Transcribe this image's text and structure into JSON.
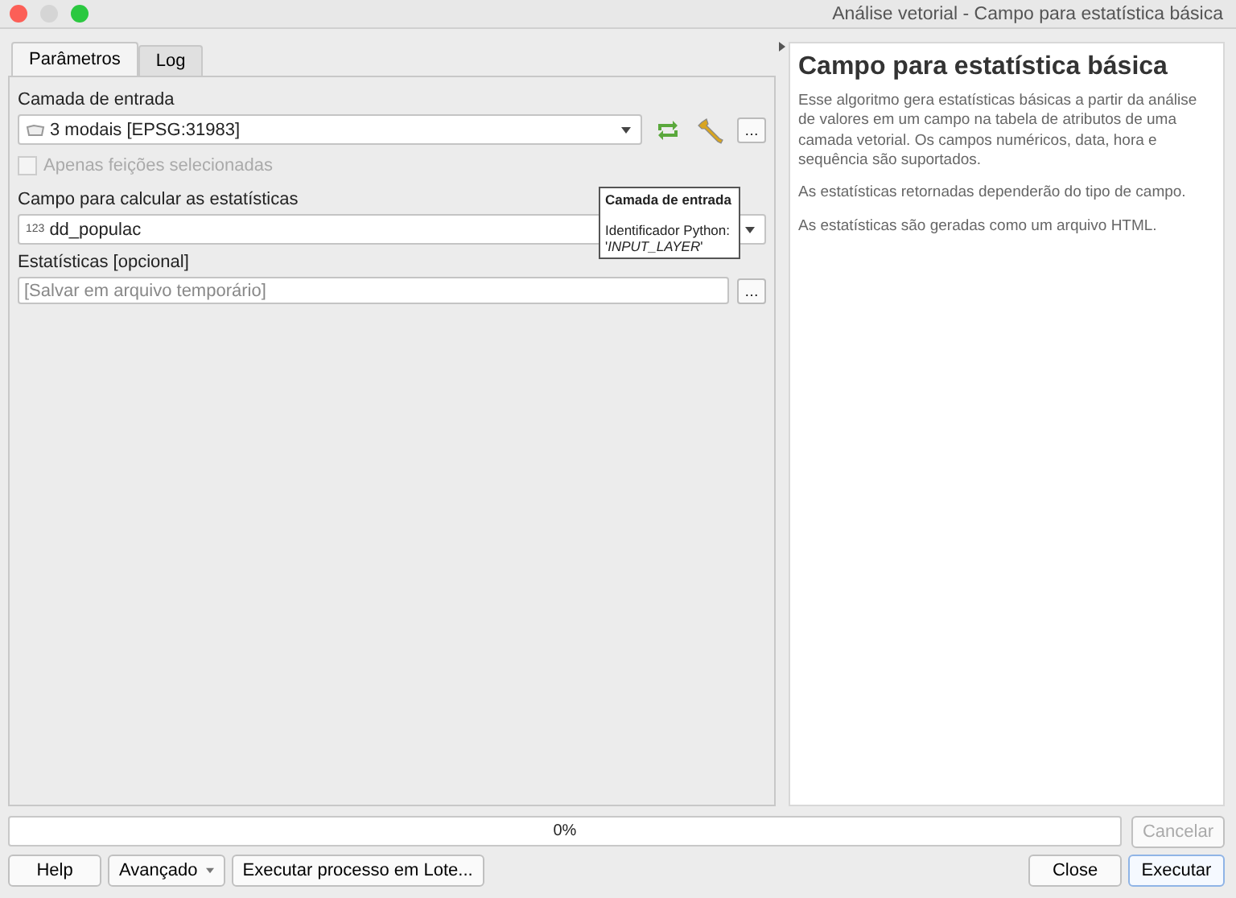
{
  "window": {
    "title": "Análise vetorial - Campo para estatística básica"
  },
  "tabs": [
    {
      "label": "Parâmetros",
      "selected": true
    },
    {
      "label": "Log",
      "selected": false
    }
  ],
  "params": {
    "input_label": "Camada de entrada",
    "input_value": "3 modais [EPSG:31983]",
    "selected_only": {
      "label": "Apenas feições selecionadas",
      "checked": false,
      "disabled": true
    },
    "field_label": "Campo para calcular as estatísticas",
    "field_type": "123",
    "field_value": "dd_populac",
    "stats_label": "Estatísticas [opcional]",
    "stats_placeholder": "[Salvar em arquivo temporário]",
    "browse": "…"
  },
  "tooltip": {
    "title": "Camada de entrada",
    "line": "Identificador Python:",
    "id_prefix": "'",
    "id": "INPUT_LAYER",
    "id_suffix": "'"
  },
  "help": {
    "title": "Campo para estatística básica",
    "paragraphs": [
      "Esse algoritmo gera estatísticas básicas a partir da análise de valores em um campo na tabela de atributos de uma camada vetorial. Os campos numéricos, data, hora e sequência são suportados.",
      "As estatísticas retornadas dependerão do tipo de campo.",
      "As estatísticas são geradas como um arquivo HTML."
    ]
  },
  "progress": {
    "level": 0,
    "reading": "0%"
  },
  "cancel": {
    "label": "Cancelar",
    "disabled": true
  },
  "buttons_left": [
    "Help",
    "Avançado",
    "Executar processo em Lote..."
  ],
  "buttons_right": [
    {
      "label": "Close",
      "default": false
    },
    {
      "label": "Executar",
      "default": true
    }
  ]
}
